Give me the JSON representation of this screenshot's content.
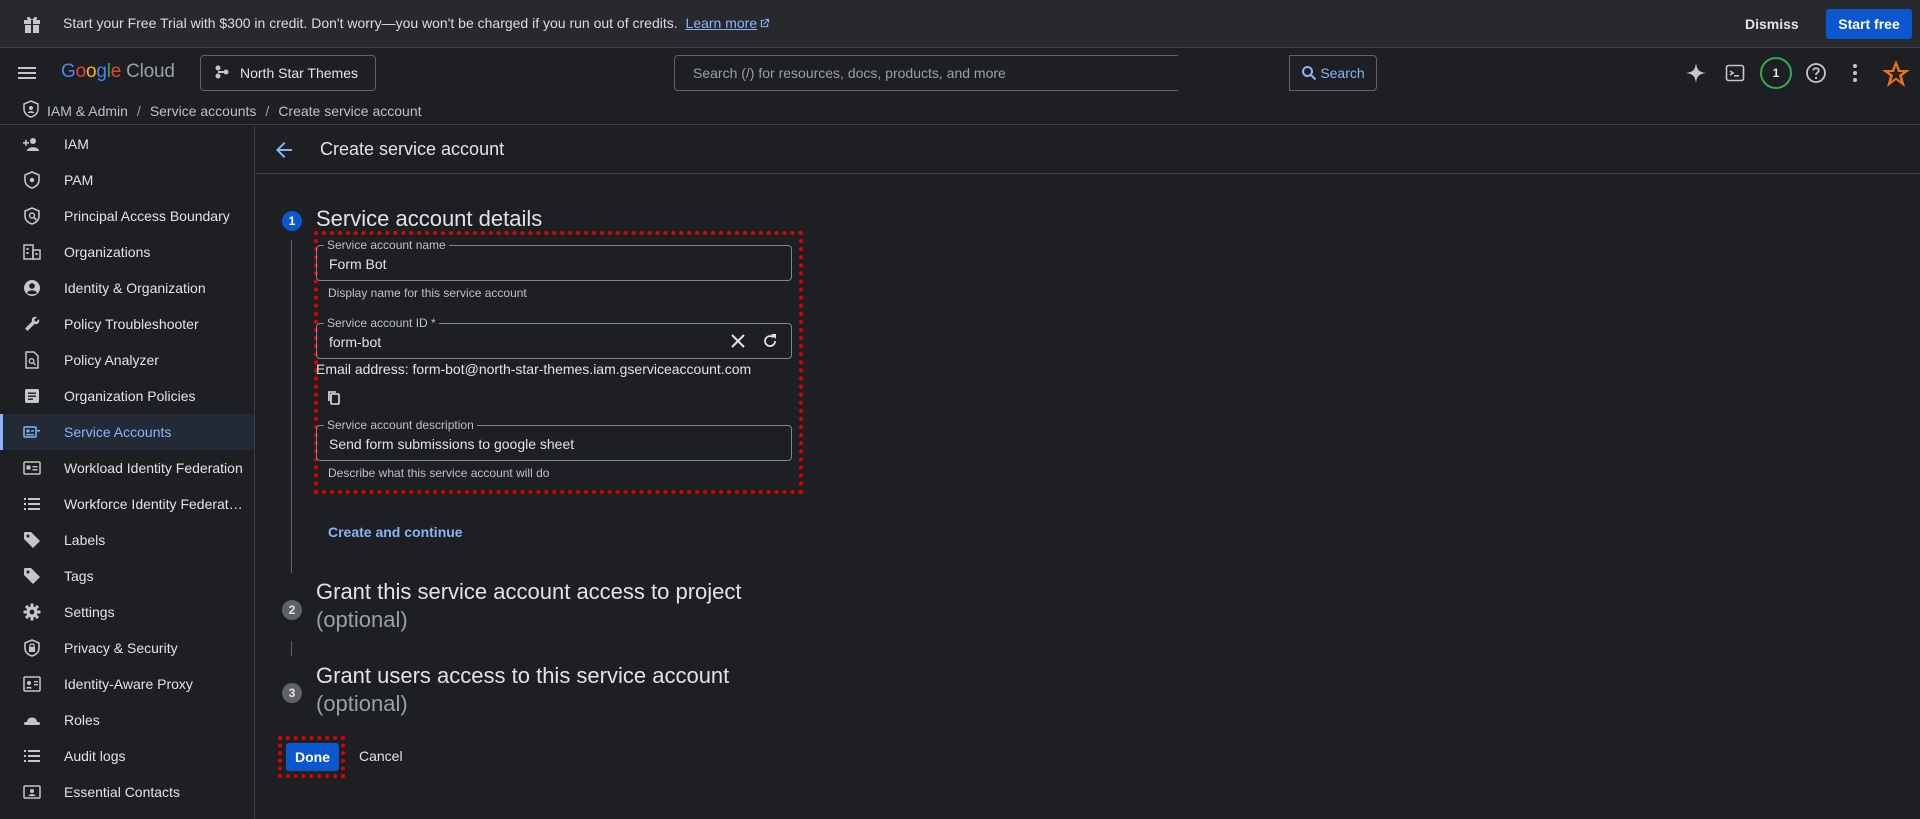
{
  "banner": {
    "message": "Start your Free Trial with $300 in credit. Don't worry—you won't be charged if you run out of credits.",
    "learn_more": "Learn more",
    "dismiss": "Dismiss",
    "start_free": "Start free"
  },
  "topbar": {
    "logo_google": "Google",
    "logo_cloud": "Cloud",
    "project": "North Star Themes",
    "search_placeholder": "Search (/) for resources, docs, products, and more",
    "search_button": "Search",
    "notifications_count": "1"
  },
  "breadcrumb": {
    "items": [
      "IAM & Admin",
      "Service accounts",
      "Create service account"
    ],
    "sep": "/"
  },
  "sidebar": {
    "items": [
      {
        "label": "IAM",
        "icon": "person-add-icon"
      },
      {
        "label": "PAM",
        "icon": "shield-icon"
      },
      {
        "label": "Principal Access Boundary",
        "icon": "policy-icon"
      },
      {
        "label": "Organizations",
        "icon": "building-icon"
      },
      {
        "label": "Identity & Organization",
        "icon": "account-circle-icon"
      },
      {
        "label": "Policy Troubleshooter",
        "icon": "wrench-icon"
      },
      {
        "label": "Policy Analyzer",
        "icon": "document-search-icon"
      },
      {
        "label": "Organization Policies",
        "icon": "list-box-icon"
      },
      {
        "label": "Service Accounts",
        "icon": "service-account-icon"
      },
      {
        "label": "Workload Identity Federation",
        "icon": "id-card-icon"
      },
      {
        "label": "Workforce Identity Federation",
        "icon": "list-icon"
      },
      {
        "label": "Labels",
        "icon": "tag-icon"
      },
      {
        "label": "Tags",
        "icon": "tag-filled-icon"
      },
      {
        "label": "Settings",
        "icon": "gear-icon"
      },
      {
        "label": "Privacy & Security",
        "icon": "shield-lock-icon"
      },
      {
        "label": "Identity-Aware Proxy",
        "icon": "proxy-icon"
      },
      {
        "label": "Roles",
        "icon": "hat-icon"
      },
      {
        "label": "Audit logs",
        "icon": "list-icon"
      },
      {
        "label": "Essential Contacts",
        "icon": "contacts-icon"
      }
    ],
    "active_index": 8
  },
  "page": {
    "title": "Create service account"
  },
  "steps": [
    {
      "num": "1",
      "title": "Service account details",
      "optional": ""
    },
    {
      "num": "2",
      "title": "Grant this service account access to project",
      "optional": "(optional)"
    },
    {
      "num": "3",
      "title": "Grant users access to this service account",
      "optional": "(optional)"
    }
  ],
  "form": {
    "name_label": "Service account name",
    "name_value": "Form Bot",
    "name_hint": "Display name for this service account",
    "id_label": "Service account ID *",
    "id_value": "form-bot",
    "email": "Email address: form-bot@north-star-themes.iam.gserviceaccount.com",
    "desc_label": "Service account description",
    "desc_value": "Send form submissions to google sheet",
    "desc_hint": "Describe what this service account will do",
    "create_continue": "Create and continue"
  },
  "actions": {
    "done": "Done",
    "cancel": "Cancel"
  },
  "colors": {
    "accent": "#8ab4f8",
    "primary_button": "#0b57d0",
    "highlight": "#e00000"
  }
}
